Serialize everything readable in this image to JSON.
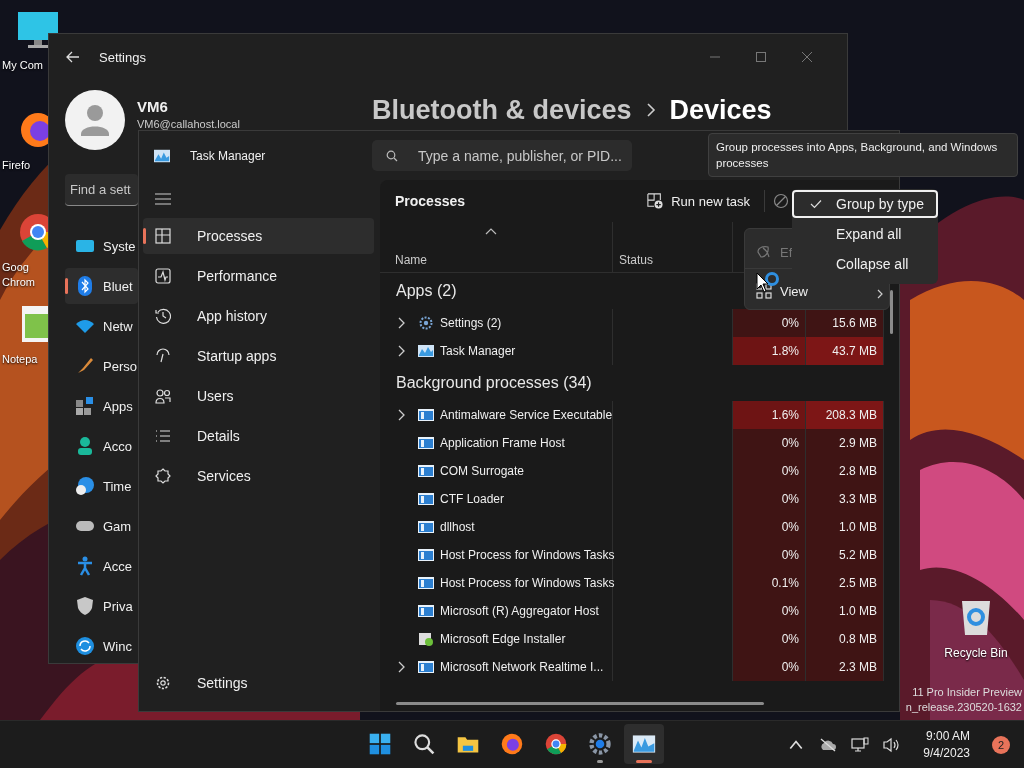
{
  "desktop": {
    "icons": [
      {
        "kind": "computer",
        "label": "My Com"
      },
      {
        "kind": "firefox",
        "label": "Firefo"
      },
      {
        "kind": "chrome",
        "label": "Goog Chrom"
      },
      {
        "kind": "notepad",
        "label": "Notepa"
      }
    ],
    "recycle_bin": {
      "label": "Recycle Bin"
    },
    "version_text": [
      "11 Pro Insider Preview",
      "n_release.230520-1632"
    ]
  },
  "settings_window": {
    "title": "Settings",
    "user": {
      "name": "VM6",
      "email": "VM6@callahost.local"
    },
    "search": {
      "placeholder": "Find a sett"
    },
    "breadcrumb": [
      "Bluetooth & devices",
      "Devices"
    ],
    "nav": [
      {
        "kind": "system",
        "label": "Syste",
        "selected": false
      },
      {
        "kind": "bluetooth",
        "label": "Bluet",
        "selected": true
      },
      {
        "kind": "network",
        "label": "Netw",
        "selected": false
      },
      {
        "kind": "personalization",
        "label": "Perso",
        "selected": false
      },
      {
        "kind": "apps",
        "label": "Apps",
        "selected": false
      },
      {
        "kind": "accounts",
        "label": "Acco",
        "selected": false
      },
      {
        "kind": "time",
        "label": "Time",
        "selected": false
      },
      {
        "kind": "gaming",
        "label": "Gam",
        "selected": false
      },
      {
        "kind": "accessibility",
        "label": "Acce",
        "selected": false
      },
      {
        "kind": "privacy",
        "label": "Priva",
        "selected": false
      },
      {
        "kind": "update",
        "label": "Winc",
        "selected": false
      }
    ]
  },
  "task_manager": {
    "title": "Task Manager",
    "search": {
      "placeholder": "Type a name, publisher, or PID..."
    },
    "nav": [
      {
        "kind": "processes",
        "label": "Processes",
        "selected": true
      },
      {
        "kind": "performance",
        "label": "Performance",
        "selected": false
      },
      {
        "kind": "history",
        "label": "App history",
        "selected": false
      },
      {
        "kind": "startup",
        "label": "Startup apps",
        "selected": false
      },
      {
        "kind": "users",
        "label": "Users",
        "selected": false
      },
      {
        "kind": "details",
        "label": "Details",
        "selected": false
      },
      {
        "kind": "services",
        "label": "Services",
        "selected": false
      }
    ],
    "settings_label": "Settings",
    "page_title": "Processes",
    "run_new_task": "Run new task",
    "columns": [
      "Name",
      "Status"
    ],
    "rows": [
      {
        "kind": "group",
        "name": "Apps (2)"
      },
      {
        "kind": "gear",
        "name": "Settings (2)",
        "expandable": true,
        "cpu": "0%",
        "memory": "15.6 MB",
        "hot": false
      },
      {
        "kind": "chart",
        "name": "Task Manager",
        "expandable": true,
        "cpu": "1.8%",
        "memory": "43.7 MB",
        "hot": true
      },
      {
        "kind": "group",
        "name": "Background processes (34)"
      },
      {
        "kind": "window",
        "name": "Antimalware Service Executable",
        "expandable": true,
        "cpu": "1.6%",
        "memory": "208.3 MB",
        "hot": true
      },
      {
        "kind": "window",
        "name": "Application Frame Host",
        "expandable": false,
        "cpu": "0%",
        "memory": "2.9 MB",
        "hot": false
      },
      {
        "kind": "window",
        "name": "COM Surrogate",
        "expandable": false,
        "cpu": "0%",
        "memory": "2.8 MB",
        "hot": false
      },
      {
        "kind": "window",
        "name": "CTF Loader",
        "expandable": false,
        "cpu": "0%",
        "memory": "3.3 MB",
        "hot": false
      },
      {
        "kind": "window",
        "name": "dllhost",
        "expandable": false,
        "cpu": "0%",
        "memory": "1.0 MB",
        "hot": false
      },
      {
        "kind": "window",
        "name": "Host Process for Windows Tasks",
        "expandable": false,
        "cpu": "0%",
        "memory": "5.2 MB",
        "hot": false
      },
      {
        "kind": "window",
        "name": "Host Process for Windows Tasks",
        "expandable": false,
        "cpu": "0.1%",
        "memory": "2.5 MB",
        "hot": false
      },
      {
        "kind": "window",
        "name": "Microsoft (R) Aggregator Host",
        "expandable": false,
        "cpu": "0%",
        "memory": "1.0 MB",
        "hot": false
      },
      {
        "kind": "installer",
        "name": "Microsoft Edge Installer",
        "expandable": false,
        "cpu": "0%",
        "memory": "0.8 MB",
        "hot": false
      },
      {
        "kind": "window",
        "name": "Microsoft Network Realtime I...",
        "expandable": true,
        "cpu": "0%",
        "memory": "2.3 MB",
        "hot": false
      }
    ],
    "more_menu": [
      {
        "kind": "efficiency",
        "label": "Ef",
        "disabled": true
      },
      {
        "kind": "view",
        "label": "View",
        "disabled": false
      }
    ],
    "view_submenu": [
      {
        "label": "Group by type",
        "checked": true,
        "focused": true
      },
      {
        "label": "Expand all",
        "checked": false,
        "focused": false
      },
      {
        "label": "Collapse all",
        "checked": false,
        "focused": false
      }
    ],
    "tooltip": "Group processes into Apps, Background, and Windows processes"
  },
  "taskbar": {
    "apps": [
      {
        "kind": "start",
        "selected": false,
        "running": false
      },
      {
        "kind": "search",
        "selected": false,
        "running": false
      },
      {
        "kind": "explorer",
        "selected": false,
        "running": false
      },
      {
        "kind": "firefox",
        "selected": false,
        "running": false
      },
      {
        "kind": "chrome",
        "selected": false,
        "running": false
      },
      {
        "kind": "settings",
        "selected": false,
        "running": true
      },
      {
        "kind": "taskmanager",
        "selected": true,
        "running": true
      }
    ],
    "time": "9:00 AM",
    "date": "9/4/2023",
    "notifications": "2"
  }
}
